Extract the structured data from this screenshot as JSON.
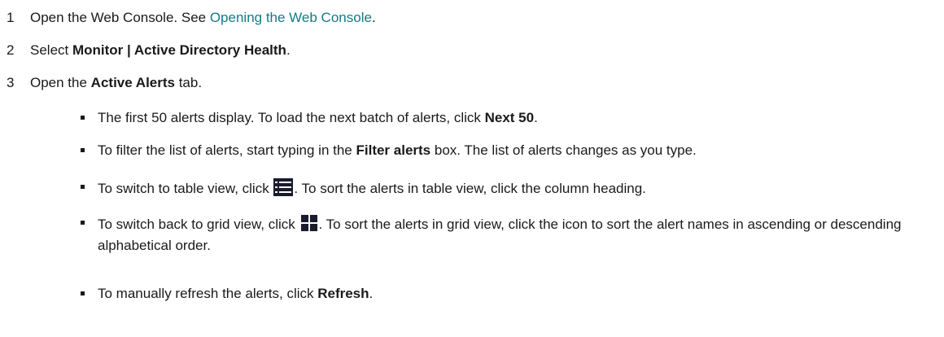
{
  "steps": [
    {
      "number": "1",
      "text_before": "Open the Web Console. See ",
      "link": "Opening the Web Console",
      "text_after": "."
    },
    {
      "number": "2",
      "text_before": "Select ",
      "bold": "Monitor | Active Directory Health",
      "text_after": "."
    },
    {
      "number": "3",
      "text_before": "Open the ",
      "bold": "Active Alerts",
      "text_after": " tab."
    }
  ],
  "bullets": {
    "b1": {
      "text_before": "The first 50 alerts display. To load the next batch of alerts, click ",
      "bold": "Next 50",
      "text_after": "."
    },
    "b2": {
      "text_before": "To filter the list of alerts, start typing in the ",
      "bold": "Filter alerts",
      "text_after": " box. The list of alerts changes as you type."
    },
    "b3": {
      "text_before": "To switch to table view, click ",
      "icon": "table-view-icon",
      "text_after": ". To sort the alerts in table view, click the column heading."
    },
    "b4": {
      "text_before": "To switch back to grid view, click ",
      "icon": "grid-view-icon",
      "text_after": ". To sort the alerts in grid view, click the icon to sort the alert names in ascending or descending alphabetical order."
    },
    "b5": {
      "text_before": "To manually refresh the alerts, click ",
      "bold": "Refresh",
      "text_after": "."
    }
  },
  "colors": {
    "link": "#137a86",
    "text": "#1a1a1a",
    "icon_dark": "#1b1b2e",
    "icon_light": "#ffffff"
  }
}
